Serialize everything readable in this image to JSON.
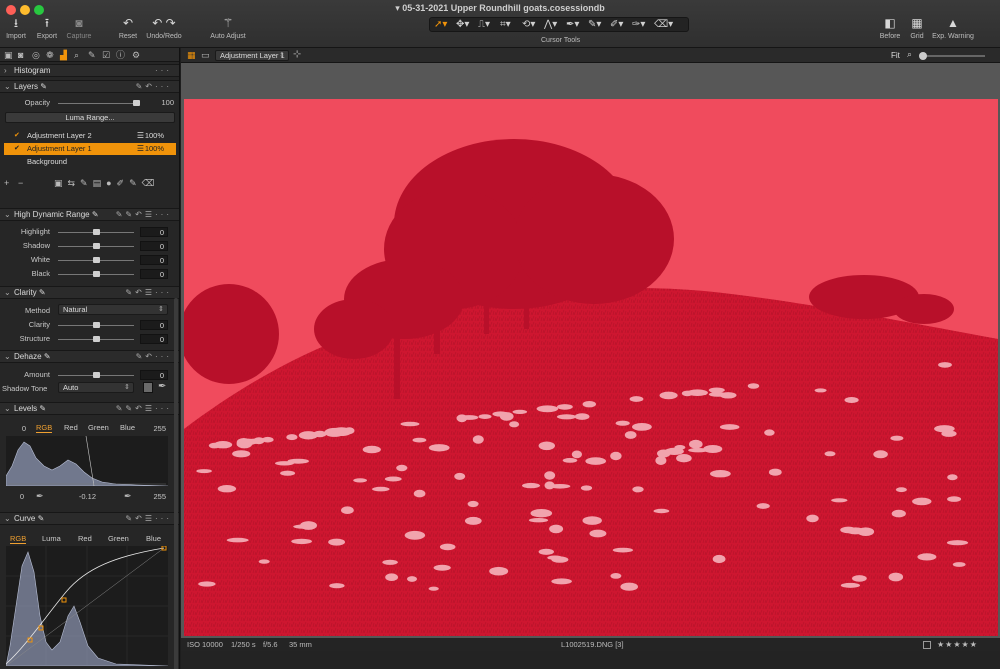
{
  "window": {
    "title": "05-31-2021 Upper Roundhill goats.cosessiondb"
  },
  "toolbar": {
    "import": "Import",
    "export": "Export",
    "capture": "Capture",
    "reset": "Reset",
    "undo_redo": "Undo/Redo",
    "auto_adjust": "Auto Adjust",
    "cursor_tools": "Cursor Tools",
    "before": "Before",
    "grid": "Grid",
    "exp_warning": "Exp. Warning"
  },
  "viewer": {
    "layer_select": "Adjustment Layer 1",
    "fit": "Fit"
  },
  "histogram": {
    "title": "Histogram"
  },
  "layers": {
    "title": "Layers",
    "opacity_label": "Opacity",
    "opacity_value": "100",
    "opacity_level": 1.0,
    "luma_range": "Luma Range...",
    "items": [
      {
        "name": "Adjustment Layer 2",
        "percent": "100%"
      },
      {
        "name": "Adjustment Layer 1",
        "percent": "100%"
      },
      {
        "name": "Background"
      }
    ]
  },
  "hdr": {
    "title": "High Dynamic Range",
    "rows": [
      {
        "label": "Highlight",
        "value": "0"
      },
      {
        "label": "Shadow",
        "value": "0"
      },
      {
        "label": "White",
        "value": "0"
      },
      {
        "label": "Black",
        "value": "0"
      }
    ]
  },
  "clarity": {
    "title": "Clarity",
    "method_label": "Method",
    "method_value": "Natural",
    "rows": [
      {
        "label": "Clarity",
        "value": "0"
      },
      {
        "label": "Structure",
        "value": "0"
      }
    ]
  },
  "dehaze": {
    "title": "Dehaze",
    "amount_label": "Amount",
    "amount_value": "0",
    "shadow_tone_label": "Shadow Tone",
    "shadow_tone_value": "Auto"
  },
  "levels": {
    "title": "Levels",
    "left_top": "0",
    "right_top": "255",
    "tabs": [
      "RGB",
      "Red",
      "Green",
      "Blue"
    ],
    "left_bottom": "0",
    "mid_bottom": "-0.12",
    "right_bottom": "255"
  },
  "curve": {
    "title": "Curve",
    "tabs": [
      "RGB",
      "Luma",
      "Red",
      "Green",
      "Blue"
    ]
  },
  "status": {
    "iso": "ISO 10000",
    "shutter": "1/250 s",
    "aperture": "f/5.6",
    "focal": "35 mm",
    "filename": "L1002519.DNG [3]"
  },
  "colors": {
    "accent": "#f0930a",
    "overlay": "#e63b4f"
  }
}
